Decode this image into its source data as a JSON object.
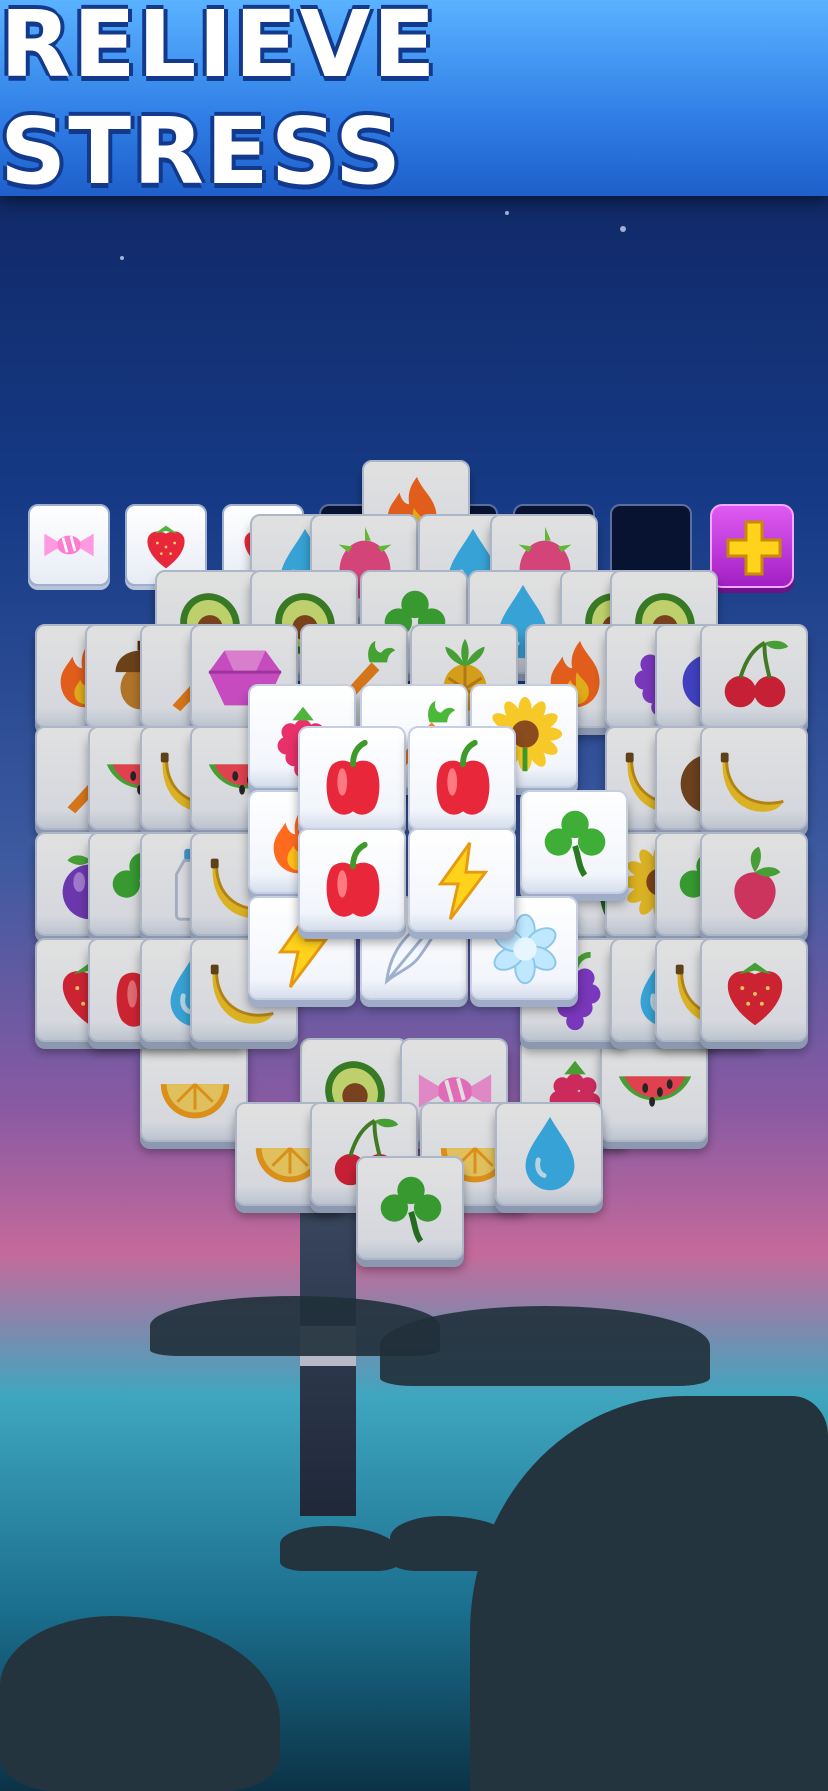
{
  "banner": {
    "title": "RELIEVE STRESS"
  },
  "colors": {
    "banner": "#2f7ee6",
    "slot_empty": "#071330",
    "add_button": "#c23ad8",
    "plus": "#ffd21c"
  },
  "slot_bar": {
    "capacity": 7,
    "slots": [
      "candy-icon",
      "strawberry-icon",
      "strawberry-icon",
      "",
      "",
      "",
      ""
    ],
    "add_button_icon": "plus-icon"
  },
  "board": {
    "tiles": [
      {
        "icon": "flame-icon"
      },
      {
        "icon": "water-drop-icon"
      },
      {
        "icon": "dragon-fruit-icon"
      },
      {
        "icon": "water-drop-icon"
      },
      {
        "icon": "dragon-fruit-icon"
      },
      {
        "icon": "avocado-icon"
      },
      {
        "icon": "avocado-icon"
      },
      {
        "icon": "clover-icon"
      },
      {
        "icon": "water-drop-icon"
      },
      {
        "icon": "avocado-icon"
      },
      {
        "icon": "avocado-icon"
      },
      {
        "icon": "flame-icon"
      },
      {
        "icon": "acorn-icon"
      },
      {
        "icon": "carrot-icon"
      },
      {
        "icon": "gem-icon"
      },
      {
        "icon": "carrot-icon"
      },
      {
        "icon": "pineapple-icon"
      },
      {
        "icon": "flame-icon"
      },
      {
        "icon": "grapes-icon"
      },
      {
        "icon": "blueberry-icon"
      },
      {
        "icon": "cherry-icon"
      },
      {
        "icon": "carrot-icon"
      },
      {
        "icon": "watermelon-icon"
      },
      {
        "icon": "banana-icon"
      },
      {
        "icon": "watermelon-icon"
      },
      {
        "icon": "banana-icon"
      },
      {
        "icon": "coconut-icon"
      },
      {
        "icon": "banana-icon"
      },
      {
        "icon": "plum-icon"
      },
      {
        "icon": "clover-icon"
      },
      {
        "icon": "milk-bottle-icon"
      },
      {
        "icon": "banana-icon"
      },
      {
        "icon": "clover-icon"
      },
      {
        "icon": "sunflower-icon"
      },
      {
        "icon": "clover-icon"
      },
      {
        "icon": "radish-icon"
      },
      {
        "icon": "strawberry-icon"
      },
      {
        "icon": "bell-pepper-icon"
      },
      {
        "icon": "water-drop-icon"
      },
      {
        "icon": "banana-icon"
      },
      {
        "icon": "grapes-icon"
      },
      {
        "icon": "water-drop-icon"
      },
      {
        "icon": "banana-icon"
      },
      {
        "icon": "strawberry-icon"
      },
      {
        "icon": "orange-slice-icon"
      },
      {
        "icon": "avocado-icon"
      },
      {
        "icon": "candy-icon"
      },
      {
        "icon": "raspberry-icon"
      },
      {
        "icon": "watermelon-icon"
      },
      {
        "icon": "orange-slice-icon"
      },
      {
        "icon": "cherry-icon"
      },
      {
        "icon": "orange-slice-icon"
      },
      {
        "icon": "water-drop-icon"
      },
      {
        "icon": "clover-icon"
      },
      {
        "icon": "raspberry-icon"
      },
      {
        "icon": "carrot-icon"
      },
      {
        "icon": "sunflower-icon"
      },
      {
        "icon": "flame-icon"
      },
      {
        "icon": "clover-icon"
      },
      {
        "icon": "lightning-icon"
      },
      {
        "icon": "feather-icon"
      },
      {
        "icon": "snowflake-icon"
      },
      {
        "icon": "bell-pepper-icon"
      },
      {
        "icon": "bell-pepper-icon"
      },
      {
        "icon": "bell-pepper-icon"
      },
      {
        "icon": "lightning-icon"
      }
    ]
  }
}
